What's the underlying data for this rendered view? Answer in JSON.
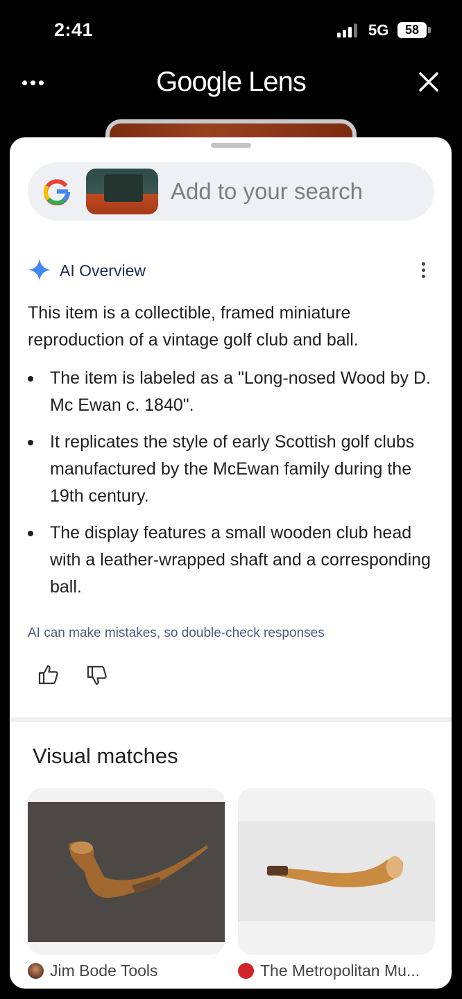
{
  "status": {
    "time": "2:41",
    "network": "5G",
    "battery": "58"
  },
  "header": {
    "title": "Google Lens"
  },
  "search": {
    "placeholder": "Add to your search"
  },
  "ai_overview": {
    "title": "AI Overview",
    "intro": "This item is a collectible, framed miniature reproduction of a vintage golf club and ball.",
    "bullets": [
      "The item is labeled as a \"Long-nosed Wood by D. Mc Ewan c. 1840\".",
      "It replicates the style of early Scottish golf clubs manufactured by the McEwan family during the 19th century.",
      "The display features a small wooden club head with a leather-wrapped shaft and a corresponding ball."
    ],
    "disclaimer": "AI can make mistakes, so double-check responses"
  },
  "visual_matches": {
    "title": "Visual matches",
    "items": [
      {
        "source": "Jim Bode Tools"
      },
      {
        "source": "The Metropolitan Mu..."
      }
    ]
  },
  "colors": {
    "accent_blue": "#4285f4",
    "sheet": "#ffffff",
    "background": "#000000"
  }
}
